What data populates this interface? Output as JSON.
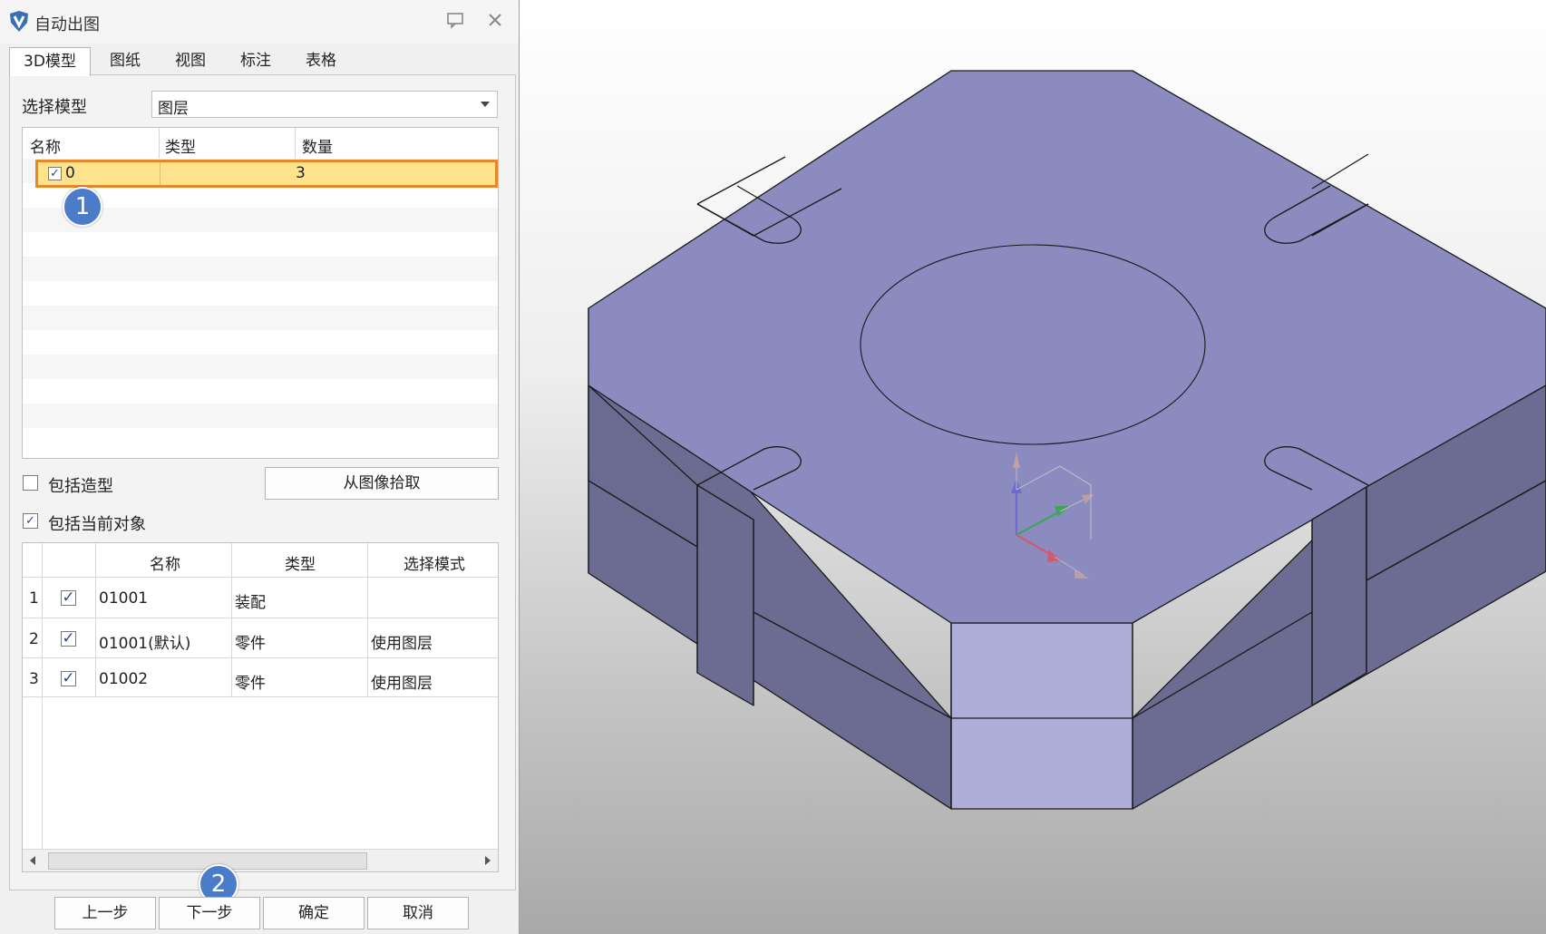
{
  "window": {
    "title": "自动出图"
  },
  "tabs": [
    {
      "label": "3D模型",
      "active": true
    },
    {
      "label": "图纸"
    },
    {
      "label": "视图"
    },
    {
      "label": "标注"
    },
    {
      "label": "表格"
    }
  ],
  "model_select": {
    "label": "选择模型",
    "value": "图层"
  },
  "layer_table": {
    "columns": [
      "名称",
      "类型",
      "数量"
    ],
    "rows": [
      {
        "checked": true,
        "name": "0",
        "type": "",
        "count": "3",
        "selected": true
      }
    ]
  },
  "options": {
    "include_features": {
      "label": "包括造型",
      "checked": false
    },
    "include_current": {
      "label": "包括当前对象",
      "checked": true
    },
    "pick_button": "从图像拾取"
  },
  "object_table": {
    "columns": [
      "名称",
      "类型",
      "选择模式"
    ],
    "rows": [
      {
        "index": "1",
        "checked": true,
        "name": "01001",
        "type": "装配",
        "mode": ""
      },
      {
        "index": "2",
        "checked": true,
        "name": "01001(默认)",
        "type": "零件",
        "mode": "使用图层"
      },
      {
        "index": "3",
        "checked": true,
        "name": "01002",
        "type": "零件",
        "mode": "使用图层"
      }
    ]
  },
  "buttons": {
    "prev": "上一步",
    "next": "下一步",
    "ok": "确定",
    "cancel": "取消"
  },
  "annotations": {
    "step1": "1",
    "step2": "2"
  },
  "colors": {
    "highlight_border": "#e8872a",
    "highlight_fill": "#fde38c",
    "badge": "#4a7cc9",
    "model_top": "#8b8bbf",
    "model_side": "#6b6b90"
  }
}
